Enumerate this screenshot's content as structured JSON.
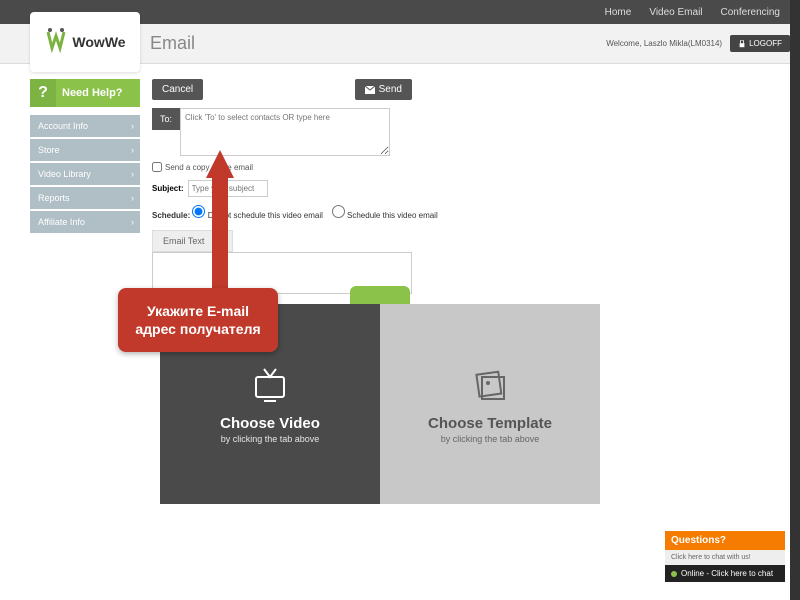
{
  "topnav": {
    "home": "Home",
    "video_email": "Video Email",
    "conferencing": "Conferencing"
  },
  "logo": {
    "text": "WowWe"
  },
  "page": {
    "title": "Email"
  },
  "header": {
    "welcome": "Welcome, Laszlo Mikla(LM0314)",
    "logoff": "LOGOFF"
  },
  "sidebar": {
    "help": "Need Help?",
    "items": [
      "Account Info",
      "Store",
      "Video Library",
      "Reports",
      "Affiliate Info"
    ]
  },
  "actions": {
    "cancel": "Cancel",
    "send": "Send"
  },
  "compose": {
    "to_label": "To:",
    "to_placeholder": "Click 'To' to select contacts OR type here",
    "send_copy": "Send a copy of the email",
    "subject_label": "Subject:",
    "subject_placeholder": "Type your subject",
    "schedule_label": "Schedule:",
    "schedule_opt1": "Do not schedule this video email",
    "schedule_opt2": "Schedule this video email",
    "tab_text": "Email Text"
  },
  "callout": {
    "text": "Укажите E-mail адрес получателя"
  },
  "panels": {
    "video": {
      "title": "Choose Video",
      "sub": "by clicking the tab above"
    },
    "template": {
      "title": "Choose Template",
      "sub": "by clicking the tab above"
    }
  },
  "chat": {
    "title": "Questions?",
    "sub": "Click here to chat with us!",
    "status": "Online - Click here to chat"
  }
}
